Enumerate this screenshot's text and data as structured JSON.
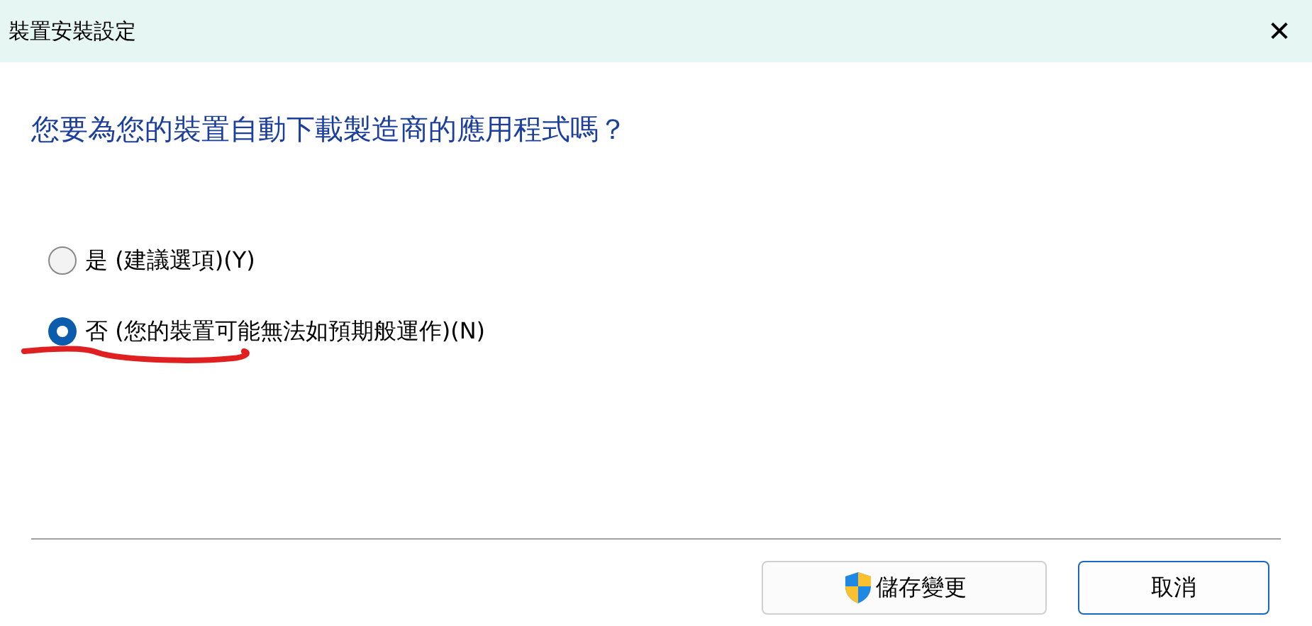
{
  "window": {
    "title": "裝置安裝設定",
    "close": "✕"
  },
  "question": "您要為您的裝置自動下載製造商的應用程式嗎？",
  "options": [
    {
      "label": "是 (建議選項)(Y)",
      "selected": false
    },
    {
      "label": "否 (您的裝置可能無法如預期般運作)(N)",
      "selected": true
    }
  ],
  "buttons": [
    {
      "label": "儲存變更",
      "kind": "shield"
    },
    {
      "label": "取消",
      "kind": "default"
    }
  ]
}
